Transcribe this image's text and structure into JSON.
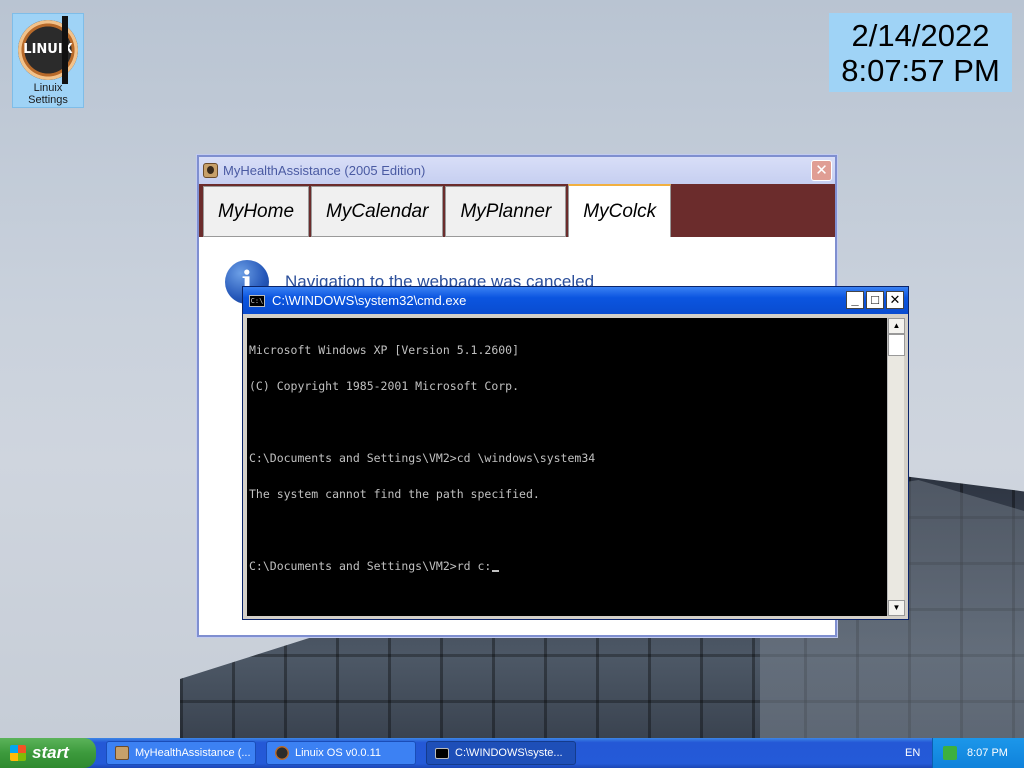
{
  "desktop": {
    "icon": {
      "logo_text": "LINUIX",
      "label": "Linuix Settings",
      "icon": "linuix-logo-icon"
    },
    "clock": {
      "date": "2/14/2022",
      "time": "8:07:57 PM"
    }
  },
  "health_window": {
    "title": "MyHealthAssistance (2005 Edition)",
    "close_label": "✕",
    "tabs": [
      {
        "label": "MyHome"
      },
      {
        "label": "MyCalendar"
      },
      {
        "label": "MyPlanner"
      },
      {
        "label": "MyColck"
      }
    ],
    "active_tab": "MyColck",
    "message": "Navigation to the webpage was canceled",
    "info_icon_glyph": "i"
  },
  "cmd_window": {
    "title": "C:\\WINDOWS\\system32\\cmd.exe",
    "icon_glyph": "C:\\",
    "controls": {
      "minimize": "_",
      "maximize": "□",
      "close": "✕"
    },
    "lines": {
      "l1": "Microsoft Windows XP [Version 5.1.2600]",
      "l2": "(C) Copyright 1985-2001 Microsoft Corp.",
      "l3": "C:\\Documents and Settings\\VM2>cd \\windows\\system34",
      "l4": "The system cannot find the path specified.",
      "l5": "C:\\Documents and Settings\\VM2>rd c:"
    },
    "scroll": {
      "up": "▲",
      "down": "▼"
    }
  },
  "taskbar": {
    "start_label": "start",
    "tasks": [
      {
        "label": "MyHealthAssistance (..."
      },
      {
        "label": "Linuix OS v0.0.11"
      },
      {
        "label": "C:\\WINDOWS\\syste..."
      }
    ],
    "language": "EN",
    "tray_time": "8:07 PM"
  },
  "colors": {
    "tab_bar": "#6b2c2c",
    "active_tab_accent": "#f2b040",
    "xp_blue": "#0b55e0",
    "start_green": "#3c9a3c",
    "widget_bg": "#9fd3f6"
  }
}
